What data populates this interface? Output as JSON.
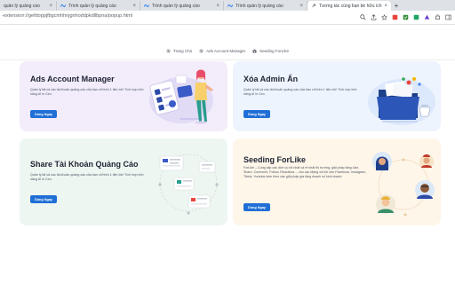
{
  "browser": {
    "tabs": [
      {
        "title": "quản lý quảng cáo",
        "active": false
      },
      {
        "title": "Trình quản lý quảng cáo",
        "active": false
      },
      {
        "title": "Trình quản lý quảng cáo",
        "active": false
      },
      {
        "title": "Trình quản lý quảng cáo",
        "active": false
      },
      {
        "title": "Tương tác cùng bạn bè hữu ích",
        "active": true
      }
    ],
    "url": "-extension://gefdoppjfbgcmhhnjgnhoddpkdllbpna/popup.html"
  },
  "nav": {
    "home": "Trang Chủ",
    "ads": "Ads Account Manager",
    "seeding": "Seeding ForLike"
  },
  "cards": {
    "ads": {
      "title": "Ads Account Manager",
      "desc": "Quản lý tất cả các tài khoản quảng cáo của bạn chỉ trên 1 tiện ích! Tích hợp tính năng AI in Ceo.",
      "button": "Dùng Ngay"
    },
    "admin": {
      "title": "Xóa Admin Ẩn",
      "desc": "Quản lý tất cả các tài khoản quảng cáo của bạn chỉ trên 1 tiện ích! Tích hợp tính năng AI in Ceo.",
      "button": "Dùng Ngay"
    },
    "share": {
      "title": "Share Tài Khoản Quảng Cáo",
      "desc": "Quản lý tất cả các tài khoản quảng cáo của bạn chỉ trên 1 tiện ích! Tích hợp tính năng AI in Ceo.",
      "button": "Dùng Ngay"
    },
    "seeding": {
      "title": "Seeding ForLike",
      "desc": "ForLike – Cung cấp các dịch vụ tốt nhất và rẻ nhất thị trường, giải pháp tăng Like, Share, Comment, Follow, Reactions… cho các Mạng xã hội như Facebook, Instagram, Tiktok, Youtube kèm theo các giải pháp gia tăng doanh số kinh doanh",
      "button": "Dùng Ngay"
    }
  },
  "colors": {
    "primary_button": "#1f6fd6",
    "card_ads_bg": "#f2ecfb",
    "card_admin_bg": "#eef4fd",
    "card_share_bg": "#eef6f1",
    "card_seeding_bg": "#fff6ea"
  }
}
